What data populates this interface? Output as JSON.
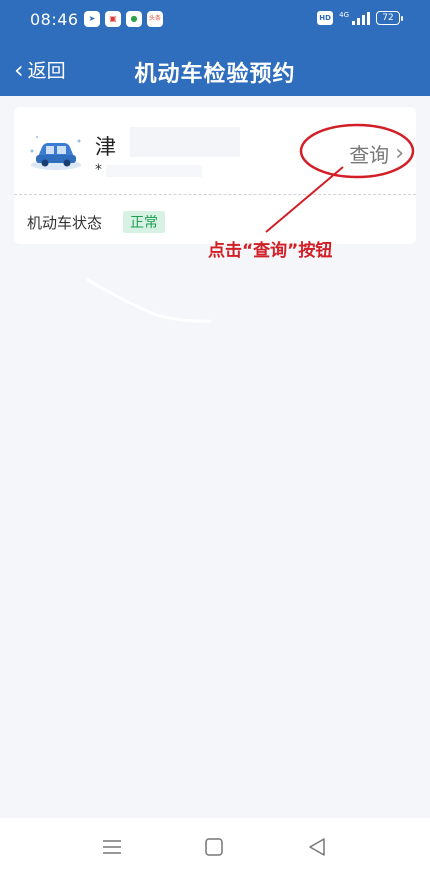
{
  "status_bar": {
    "time": "08:46",
    "app_icons": [
      {
        "name": "telegram-icon",
        "glyph": "➤",
        "style": "blue"
      },
      {
        "name": "message-icon",
        "glyph": "▣",
        "style": "red"
      },
      {
        "name": "wechat-icon",
        "glyph": "●",
        "style": "green"
      },
      {
        "name": "toutiao-icon",
        "glyph": "头条",
        "style": "orange"
      }
    ],
    "hd": "HD",
    "network": "4G",
    "battery": "72"
  },
  "header": {
    "back_label": "返回",
    "back_icon": "‹",
    "title": "机动车检验预约"
  },
  "vehicle_card": {
    "plate_prefix": "津",
    "sub_text": "*",
    "query_label": "查询",
    "query_arrow": "›",
    "status_label": "机动车状态",
    "status_value": "正常"
  },
  "annotation": {
    "text": "点击“查询”按钮",
    "color": "#d21f26"
  },
  "colors": {
    "header_bg": "#2f6dbd",
    "page_bg": "#f4f6f9",
    "badge_bg": "#d7f2e3",
    "badge_text": "#1f9d55"
  },
  "system_nav": {
    "menu_icon": "menu-icon",
    "home_icon": "home-icon",
    "back_icon": "back-triangle-icon"
  }
}
